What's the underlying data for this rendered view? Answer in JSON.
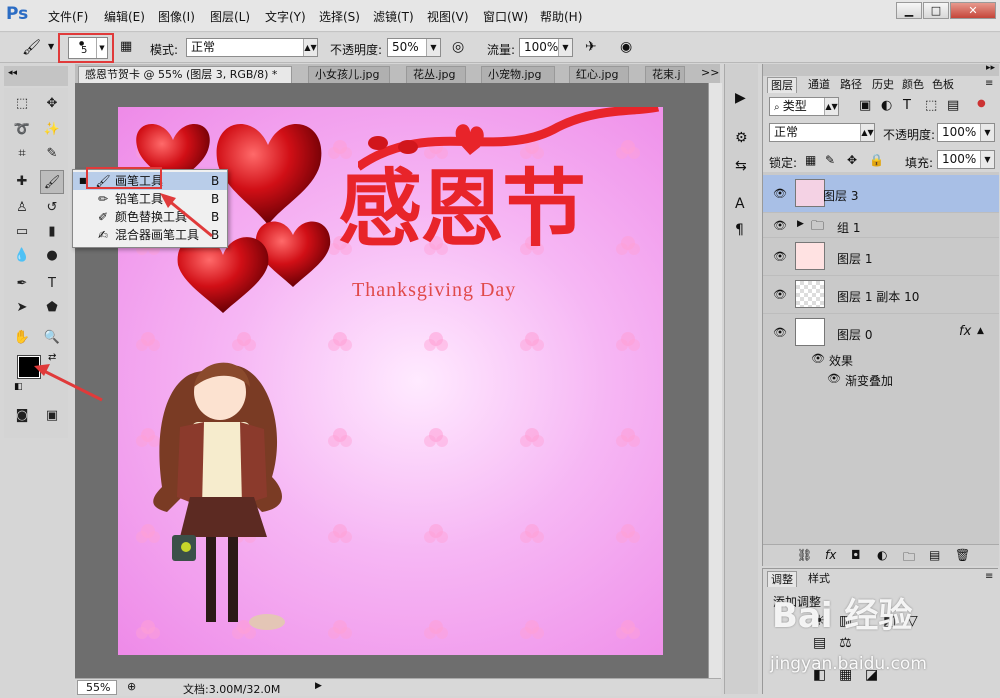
{
  "app": {
    "logo": "Ps"
  },
  "menu": [
    "文件(F)",
    "编辑(E)",
    "图像(I)",
    "图层(L)",
    "文字(Y)",
    "选择(S)",
    "滤镜(T)",
    "视图(V)",
    "窗口(W)",
    "帮助(H)"
  ],
  "window_buttons": [
    "▁",
    "□",
    "✕"
  ],
  "options": {
    "brush_size": "5",
    "mode_label": "模式:",
    "mode_value": "正常",
    "opacity_label": "不透明度:",
    "opacity_value": "50%",
    "flow_label": "流量:",
    "flow_value": "100%"
  },
  "tabs": [
    "感恩节贺卡 @ 55% (图层 3, RGB/8) *",
    "小女孩儿.jpg",
    "花丛.jpg",
    "小宠物.jpg",
    "红心.jpg",
    "花束.j"
  ],
  "tabs_overflow": ">>",
  "flyout": [
    {
      "label": "画笔工具",
      "key": "B",
      "active": true
    },
    {
      "label": "铅笔工具",
      "key": "B"
    },
    {
      "label": "颜色替换工具",
      "key": "B"
    },
    {
      "label": "混合器画笔工具",
      "key": "B"
    }
  ],
  "canvas": {
    "title_cn": "感恩节",
    "subtitle": "Thanksgiving Day"
  },
  "status": {
    "zoom": "55%",
    "doc": "文档:3.00M/32.0M"
  },
  "panel_tabs": [
    "图层",
    "通道",
    "路径",
    "历史",
    "颜色",
    "色板"
  ],
  "layers_panel": {
    "filter_value": "类型",
    "blend_value": "正常",
    "opacity_label": "不透明度:",
    "opacity_value": "100%",
    "lock_label": "锁定:",
    "fill_label": "填充:",
    "fill_value": "100%"
  },
  "layers": [
    {
      "name": "图层 3",
      "selected": true
    },
    {
      "name": "组 1",
      "group": true
    },
    {
      "name": "图层 1"
    },
    {
      "name": "图层 1 副本 10"
    },
    {
      "name": "图层 0",
      "fx": "fx"
    }
  ],
  "effects": {
    "label": "效果",
    "item": "渐变叠加"
  },
  "adj_tabs": [
    "调整",
    "样式"
  ],
  "adj_title": "添加调整",
  "watermark": {
    "main": "Bai 经验",
    "url": "jingyan.baidu.com"
  }
}
